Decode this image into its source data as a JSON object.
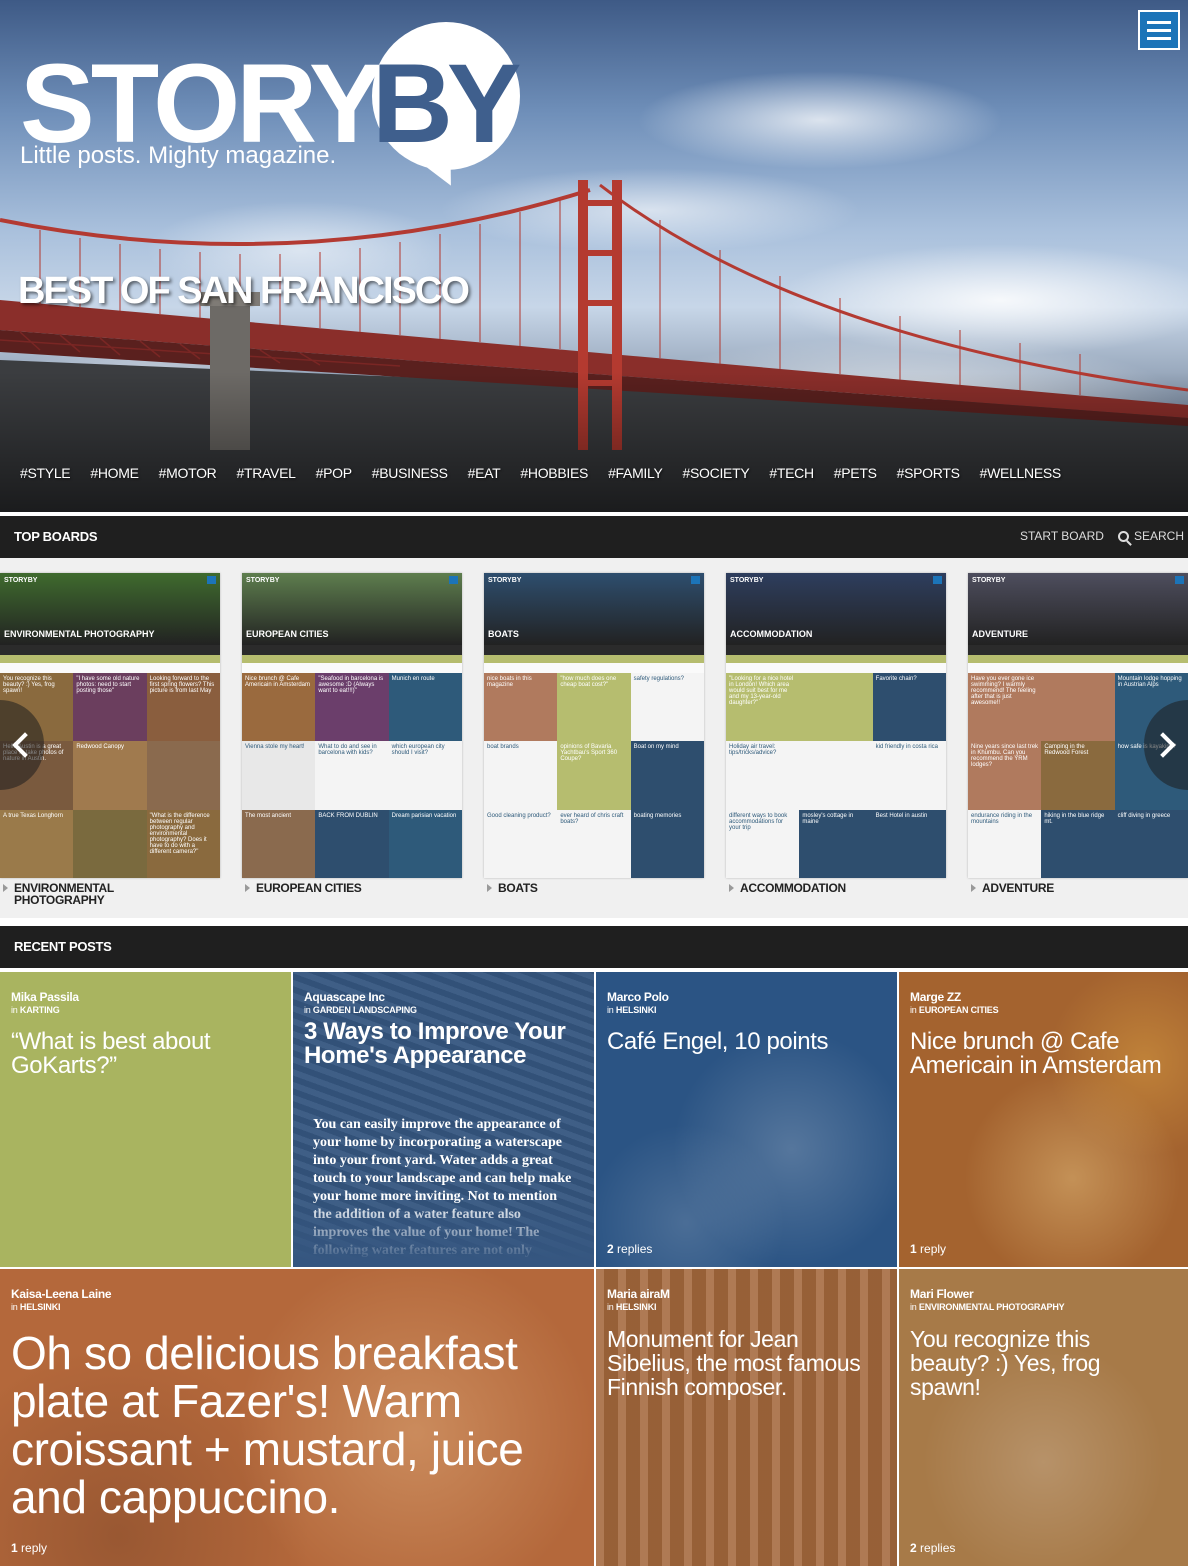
{
  "brand": {
    "wordmark": "STORY",
    "wordmark_by": "BY",
    "tagline": "Little posts. Mighty magazine."
  },
  "hero": {
    "title": "BEST OF SAN FRANCISCO",
    "hashtags": [
      "#STYLE",
      "#HOME",
      "#MOTOR",
      "#TRAVEL",
      "#POP",
      "#BUSINESS",
      "#EAT",
      "#HOBBIES",
      "#FAMILY",
      "#SOCIETY",
      "#TECH",
      "#PETS",
      "#SPORTS",
      "#WELLNESS"
    ]
  },
  "top_boards": {
    "label": "TOP BOARDS",
    "start_board": "START BOARD",
    "search": "SEARCH",
    "boards": [
      {
        "name": "ENVIRONMENTAL PHOTOGRAPHY",
        "caption_line1": "ENVIRONMENTAL",
        "caption_line2": "PHOTOGRAPHY",
        "header_color": "#3f6b2e",
        "tiles": [
          "You recognize this beauty? :) Yes, frog spawn!",
          "\"I have some old nature photos: need to start posting those\"",
          "Looking forward to the first spring flowers? This picture is from last May",
          "Hello Austin is a great place to take photos of nature in Austin.",
          "Redwood Canopy",
          "",
          "A true Texas Longhorn",
          "",
          "\"What is the difference between regular photography and environmental photography? Does it have to do with a different camera?\""
        ],
        "tile_colors": [
          "#8a6a3e",
          "#6b3e5e",
          "#8a5e3e",
          "#7a5a3e",
          "#a07a4e",
          "#8a6a4e",
          "#9a7a4a",
          "#7a6a3e",
          "#8a6a3e"
        ]
      },
      {
        "name": "EUROPEAN CITIES",
        "caption_line1": "EUROPEAN CITIES",
        "caption_line2": "",
        "header_color": "#5e7e4e",
        "tiles": [
          "Nice brunch @ Cafe Americain in Amsterdam",
          "\"Seafood in barcelona is awesome :D (Always want to eat!!!)\"",
          "Munich en route",
          "Vienna stole my heart!",
          "What to do and see in barcelona with kids?",
          "which european city should I visit?",
          "The most ancient",
          "BACK FROM DUBLIN",
          "Dream parisian vacation"
        ],
        "tile_colors": [
          "#9a6a3e",
          "#6b3e6b",
          "#2e5a7a",
          "#e8e8e8",
          "#f4f4f4",
          "#f4f4f4",
          "#8a6a4e",
          "#2e4e6e",
          "#2e5a7a"
        ]
      },
      {
        "name": "BOATS",
        "caption_line1": "BOATS",
        "caption_line2": "",
        "header_color": "#2e4e6e",
        "tiles": [
          "nice boats in this magazine",
          "\"how much does one cheap boat cost?\"",
          "safety regulations?",
          "boat brands",
          "opinions of Bavaria Yachtbau's Sport 360 Coupe?",
          "Boat on my mind",
          "Good cleaning product?",
          "ever heard of chris craft boats?",
          "boating memories"
        ],
        "tile_colors": [
          "#b07a5e",
          "#b6bd6f",
          "#f4f4f4",
          "#f4f4f4",
          "#b6bd6f",
          "#2e4e6e",
          "#f4f4f4",
          "#f4f4f4",
          "#2e4e6e"
        ]
      },
      {
        "name": "ACCOMMODATION",
        "caption_line1": "ACCOMMODATION",
        "caption_line2": "",
        "header_color": "#2e3e5e",
        "tiles": [
          "\"Looking for a nice hotel in London! Which area would suit best for me and my 13-year-old daughter?\"",
          "",
          "Favorite chain?",
          "Holiday air travel: tips/tricks/advice?",
          "",
          "kid friendly in costa rica",
          "different ways to book accommodations for your trip",
          "mosley's cottage in maine",
          "Best Hotel in austin"
        ],
        "tile_colors": [
          "#b6bd6f",
          "#b6bd6f",
          "#2e4e6e",
          "#f4f4f4",
          "#f4f4f4",
          "#f4f4f4",
          "#f4f4f4",
          "#2e4e6e",
          "#2e4e6e"
        ]
      },
      {
        "name": "ADVENTURE",
        "caption_line1": "ADVENTURE",
        "caption_line2": "",
        "header_color": "#4e4e5e",
        "tiles": [
          "Have you ever gone ice swimming? I warmly recommend! The feeling after that is just awesome!!",
          "",
          "Mountain lodge hopping in Austrian Alps",
          "Nine years since last trek in Khumbu. Can you recommend the YRM lodges?",
          "Camping in the Redwood Forest",
          "how safe is kayaking?",
          "endurance riding in the mountains",
          "hiking in the blue ridge mt.",
          "cliff diving in greece"
        ],
        "tile_colors": [
          "#b07a5e",
          "#b07a5e",
          "#2e5a7a",
          "#b07a5e",
          "#8a6a3e",
          "#2e5a7a",
          "#f4f4f4",
          "#2e4e6e",
          "#2e4e6e"
        ]
      }
    ]
  },
  "recent_posts": {
    "label": "RECENT POSTS",
    "in_prefix": "in",
    "posts": [
      {
        "author": "Mika Passila",
        "board": "KARTING",
        "title": "“What is best about GoKarts?”",
        "replies_count": "",
        "replies_word": "",
        "color": "#a9b460"
      },
      {
        "author": "Aquascape Inc",
        "board": "GARDEN LANDSCAPING",
        "title": "3 Ways to Improve Your Home's Appearance",
        "body": "You can easily improve the appearance of your home by incorporating a waterscape into your front yard. Water adds a great touch to your landscape and can help make your home more inviting. Not to mention the addition of a water feature also improves the value of your home! The following water features are not only beautifully refreshing",
        "replies_count": "",
        "replies_word": "",
        "color": "#355680"
      },
      {
        "author": "Marco Polo",
        "board": "HELSINKI",
        "title": "Café Engel, 10 points",
        "replies_count": "2",
        "replies_word": "replies",
        "color": "#2b5484"
      },
      {
        "author": "Marge ZZ",
        "board": "EUROPEAN CITIES",
        "title": "Nice brunch @ Cafe Americain in Amsterdam",
        "replies_count": "1",
        "replies_word": "reply",
        "color": "#a4632f"
      },
      {
        "author": "Kaisa-Leena Laine",
        "board": "HELSINKI",
        "title": "Oh so delicious breakfast plate at Fazer's! Warm croissant + mustard, juice and cappuccino.",
        "replies_count": "1",
        "replies_word": "reply",
        "color": "#b4683b"
      },
      {
        "author": "Maria airaM",
        "board": "HELSINKI",
        "title": "Monument for Jean Sibelius, the most famous Finnish composer.",
        "replies_count": "",
        "replies_word": "",
        "color": "#a4683c"
      },
      {
        "author": "Mari Flower",
        "board": "ENVIRONMENTAL PHOTOGRAPHY",
        "title": "You recognize this beauty? :) Yes, frog spawn!",
        "replies_count": "2",
        "replies_word": "replies",
        "color": "#a77a48"
      }
    ]
  },
  "icons": {
    "menu": "hamburger-menu-icon",
    "search": "search-icon",
    "prev": "chevron-left-icon",
    "next": "chevron-right-icon"
  }
}
